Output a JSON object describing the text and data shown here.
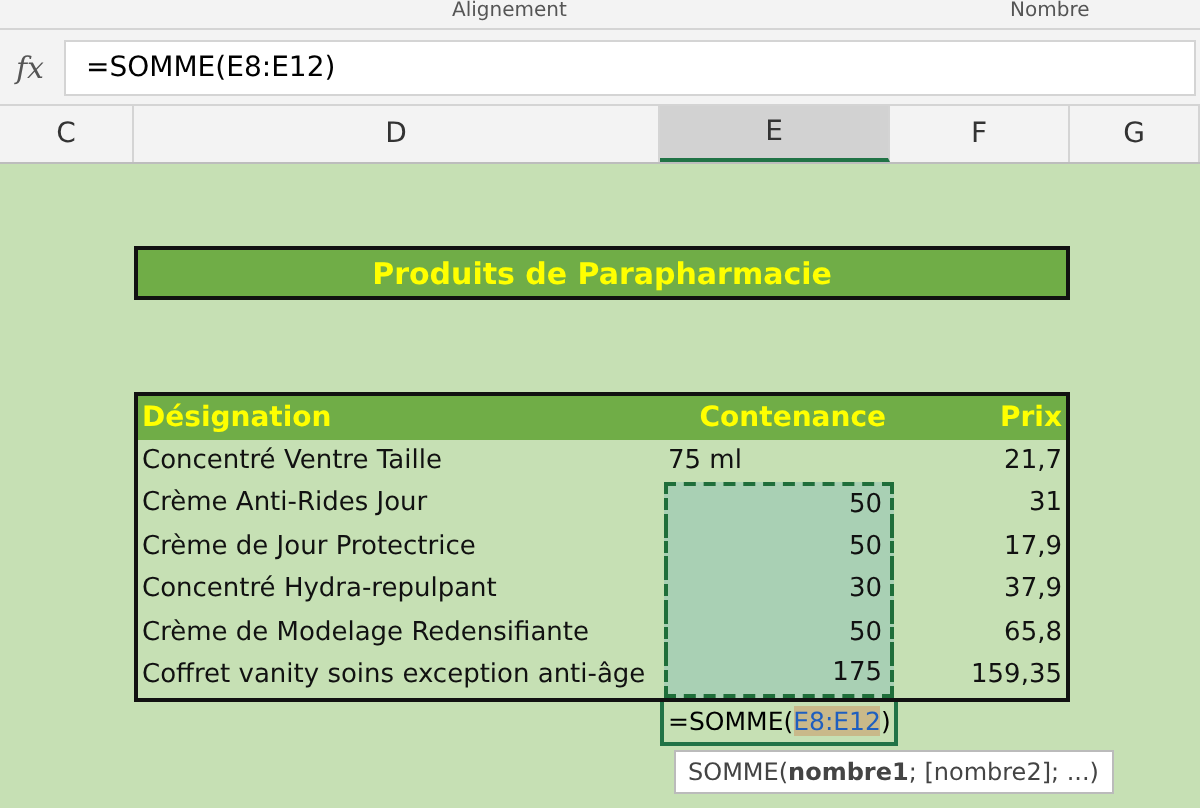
{
  "ribbon": {
    "groups": [
      "Alignement",
      "Nombre"
    ]
  },
  "formula_bar": {
    "fx": "fx",
    "value": "=SOMME(E8:E12)"
  },
  "columns": [
    {
      "label": "C",
      "selected": false
    },
    {
      "label": "D",
      "selected": false
    },
    {
      "label": "E",
      "selected": true
    },
    {
      "label": "F",
      "selected": false
    },
    {
      "label": "G",
      "selected": false
    }
  ],
  "title": "Produits de Parapharmacie",
  "table": {
    "headers": [
      "Désignation",
      "Contenance",
      "Prix"
    ],
    "rows": [
      {
        "designation": "Concentré Ventre Taille",
        "contenance": "75 ml",
        "prix": "21,7",
        "in_range": false
      },
      {
        "designation": "Crème Anti-Rides Jour",
        "contenance": "50",
        "prix": "31",
        "in_range": true
      },
      {
        "designation": "Crème de Jour Protectrice",
        "contenance": "50",
        "prix": "17,9",
        "in_range": true
      },
      {
        "designation": "Concentré Hydra-repulpant",
        "contenance": "30",
        "prix": "37,9",
        "in_range": true
      },
      {
        "designation": "Crème de Modelage Redensifiante",
        "contenance": "50",
        "prix": "65,8",
        "in_range": true
      },
      {
        "designation": "Coffret vanity soins exception anti-âge",
        "contenance": "175",
        "prix": "159,35",
        "in_range": true
      }
    ]
  },
  "edit_cell": {
    "prefix": "=SOMME(",
    "reference": "E8:E12",
    "suffix": ")"
  },
  "tooltip": "SOMME(**nombre1**; [nombre2]; ...)"
}
